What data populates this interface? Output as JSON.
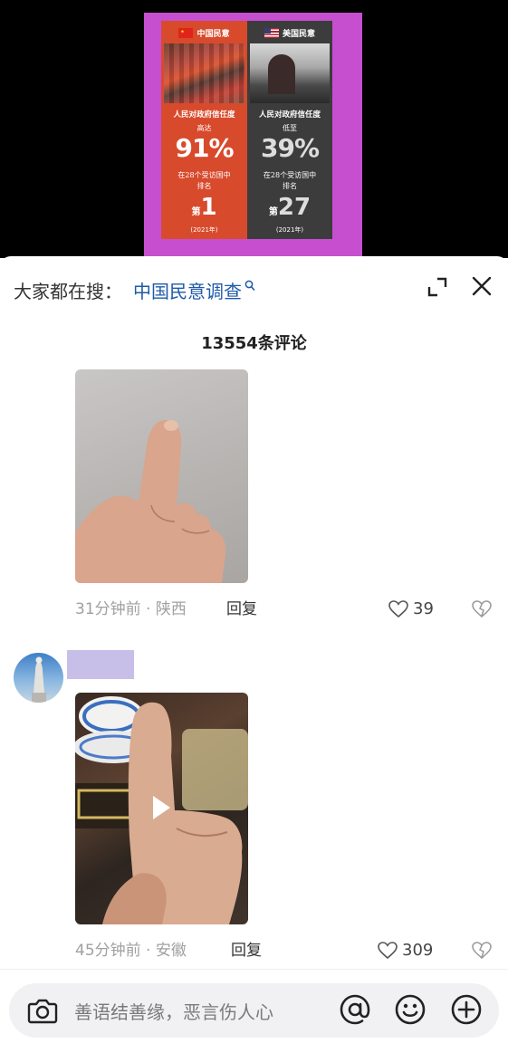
{
  "poster": {
    "left_header": "中国民意",
    "right_header": "美国民意",
    "left_title": "人民对政府信任度",
    "right_title": "人民对政府信任度",
    "left_sub": "高达",
    "right_sub": "低至",
    "left_pct": "91%",
    "right_pct": "39%",
    "rank_label_line1": "在28个受访国中",
    "rank_label_line2": "排名",
    "rank_prefix": "第",
    "left_rank": "1",
    "right_rank": "27",
    "year": "(2021年)"
  },
  "header": {
    "search_label": "大家都在搜：",
    "search_term": "中国民意调查"
  },
  "comment_count": "13554条评论",
  "comments": [
    {
      "time_location": "31分钟前 · 陕西",
      "reply_label": "回复",
      "likes": "39"
    },
    {
      "time_location": "45分钟前 · 安徽",
      "reply_label": "回复",
      "likes": "309"
    }
  ],
  "input": {
    "placeholder": "善语结善缘，恶言伤人心"
  },
  "colors": {
    "accent_link": "#1f5aa8",
    "poster_frame": "#c64fd0",
    "poster_left": "#d84a2c",
    "poster_right": "#3c3c3c"
  }
}
